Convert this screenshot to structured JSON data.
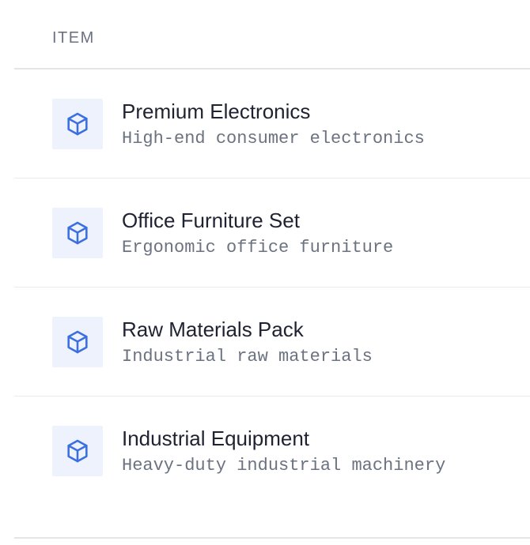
{
  "table": {
    "header": "ITEM",
    "rows": [
      {
        "title": "Premium Electronics",
        "description": "High-end consumer electronics",
        "icon": "package-icon"
      },
      {
        "title": "Office Furniture Set",
        "description": "Ergonomic office furniture",
        "icon": "package-icon"
      },
      {
        "title": "Raw Materials Pack",
        "description": "Industrial raw materials",
        "icon": "package-icon"
      },
      {
        "title": "Industrial Equipment",
        "description": "Heavy-duty industrial machinery",
        "icon": "package-icon"
      }
    ]
  },
  "colors": {
    "icon": "#3b6fe0",
    "icon_bg": "#edf2fd",
    "title": "#1f2230",
    "muted": "#6b7280",
    "divider": "#e3e5e8"
  }
}
